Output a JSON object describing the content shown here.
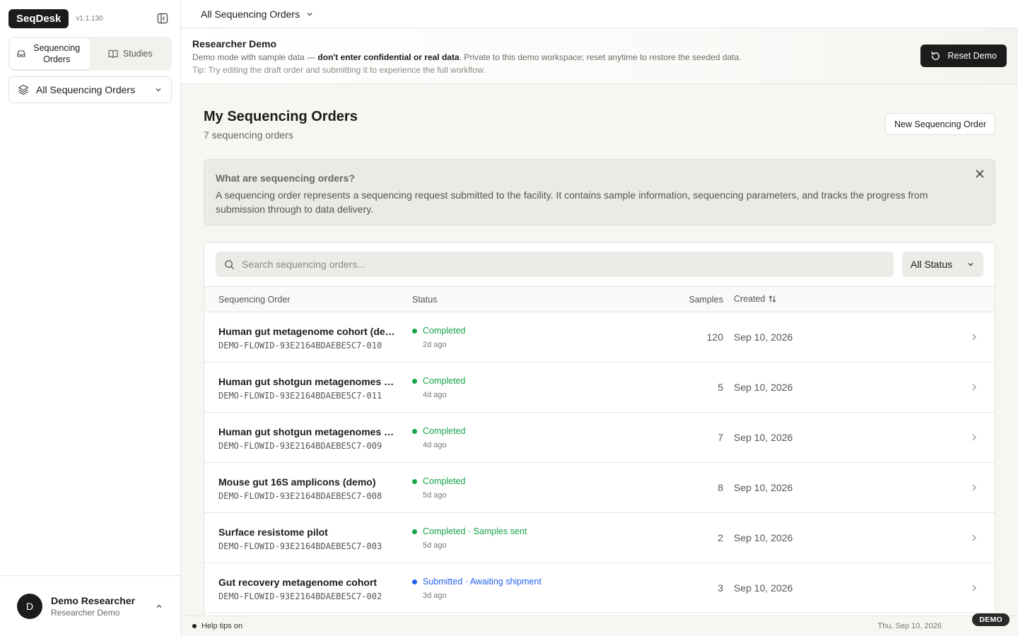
{
  "app": {
    "brand": "SeqDesk",
    "version": "v1.1.130"
  },
  "sidebar": {
    "tabs": [
      {
        "label": "Sequencing Orders",
        "icon": "inbox-icon",
        "active": true
      },
      {
        "label": "Studies",
        "icon": "book-icon",
        "active": false
      }
    ],
    "scope": "All Sequencing Orders",
    "user": {
      "initial": "D",
      "name": "Demo Researcher",
      "role": "Researcher Demo"
    }
  },
  "topbar": {
    "scope": "All Sequencing Orders"
  },
  "banner": {
    "title": "Researcher Demo",
    "line_pre": "Demo mode with sample data — ",
    "line_bold": "don't enter confidential or real data",
    "line_post": ". Private to this demo workspace; reset anytime to restore the seeded data.",
    "tip": "Tip: Try editing the draft order and submitting it to experience the full workflow.",
    "reset_label": "Reset Demo"
  },
  "page": {
    "title": "My Sequencing Orders",
    "subtitle": "7 sequencing orders",
    "new_button": "New Sequencing Order"
  },
  "info": {
    "title": "What are sequencing orders?",
    "body": "A sequencing order represents a sequencing request submitted to the facility. It contains sample information, sequencing parameters, and tracks the progress from submission through to data delivery."
  },
  "table": {
    "search_placeholder": "Search sequencing orders...",
    "status_filter": "All Status",
    "headers": {
      "order": "Sequencing Order",
      "status": "Status",
      "samples": "Samples",
      "created": "Created"
    },
    "rows": [
      {
        "name": "Human gut metagenome cohort (demo)",
        "id": "DEMO-FLOWID-93E2164BDAEBE5C7-010",
        "status": "Completed",
        "status_color": "#16a34a",
        "age": "2d ago",
        "samples": "120",
        "created": "Sep 10, 2026"
      },
      {
        "name": "Human gut shotgun metagenomes — batch",
        "id": "DEMO-FLOWID-93E2164BDAEBE5C7-011",
        "status": "Completed",
        "status_color": "#16a34a",
        "age": "4d ago",
        "samples": "5",
        "created": "Sep 10, 2026"
      },
      {
        "name": "Human gut shotgun metagenomes — pilot",
        "id": "DEMO-FLOWID-93E2164BDAEBE5C7-009",
        "status": "Completed",
        "status_color": "#16a34a",
        "age": "4d ago",
        "samples": "7",
        "created": "Sep 10, 2026"
      },
      {
        "name": "Mouse gut 16S amplicons (demo)",
        "id": "DEMO-FLOWID-93E2164BDAEBE5C7-008",
        "status": "Completed",
        "status_color": "#16a34a",
        "age": "5d ago",
        "samples": "8",
        "created": "Sep 10, 2026"
      },
      {
        "name": "Surface resistome pilot",
        "id": "DEMO-FLOWID-93E2164BDAEBE5C7-003",
        "status": "Completed · Samples sent",
        "status_color": "#16a34a",
        "age": "5d ago",
        "samples": "2",
        "created": "Sep 10, 2026"
      },
      {
        "name": "Gut recovery metagenome cohort",
        "id": "DEMO-FLOWID-93E2164BDAEBE5C7-002",
        "status": "Submitted · Awaiting shipment",
        "status_color": "#2563eb",
        "age": "3d ago",
        "samples": "3",
        "created": "Sep 10, 2026"
      },
      {
        "name": "",
        "id": "",
        "status": "",
        "status_color": "#16a34a",
        "age": "",
        "samples": "",
        "created": ""
      }
    ]
  },
  "footer": {
    "help": "Help tips on",
    "date": "Thu, Sep 10, 2026",
    "badge": "DEMO"
  }
}
